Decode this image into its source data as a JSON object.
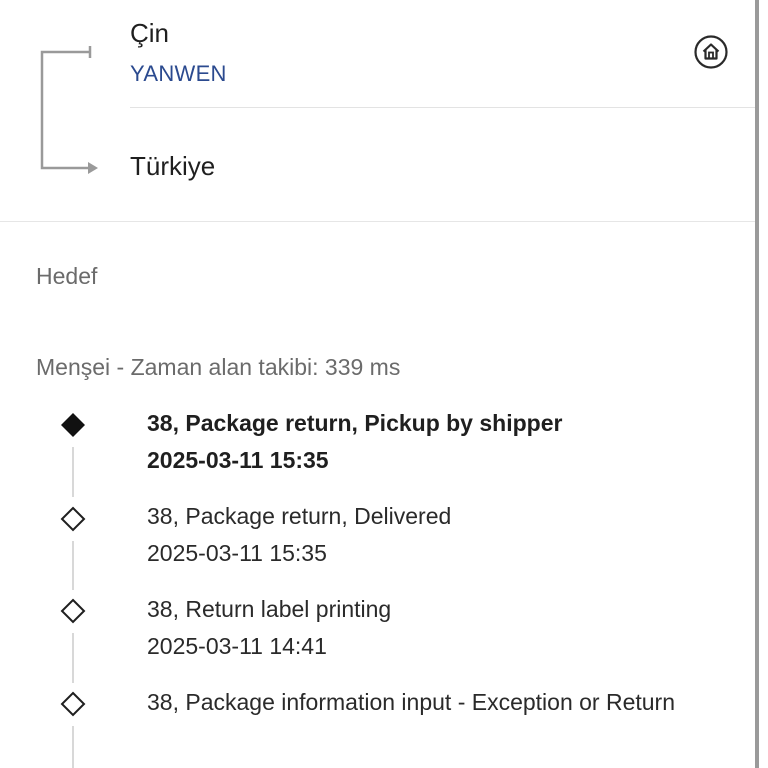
{
  "route": {
    "origin_country": "Çin",
    "carrier": "YANWEN",
    "destination_country": "Türkiye",
    "home_icon": "home-icon"
  },
  "destination_section": {
    "label": "Hedef"
  },
  "origin_section": {
    "heading": "Menşei - Zaman alan takibi: 339 ms"
  },
  "events": [
    {
      "description": "38, Package return, Pickup by shipper",
      "time": "2025-03-11 15:35",
      "latest": true
    },
    {
      "description": "38, Package return, Delivered",
      "time": "2025-03-11 15:35",
      "latest": false
    },
    {
      "description": "38, Return label printing",
      "time": "2025-03-11 14:41",
      "latest": false
    },
    {
      "description": "38, Package information input - Exception or Return",
      "time": "",
      "latest": false
    }
  ],
  "colors": {
    "carrier": "#2b4a8f",
    "muted_text": "#6b6b6b",
    "timeline_line": "#d8d8d8"
  }
}
